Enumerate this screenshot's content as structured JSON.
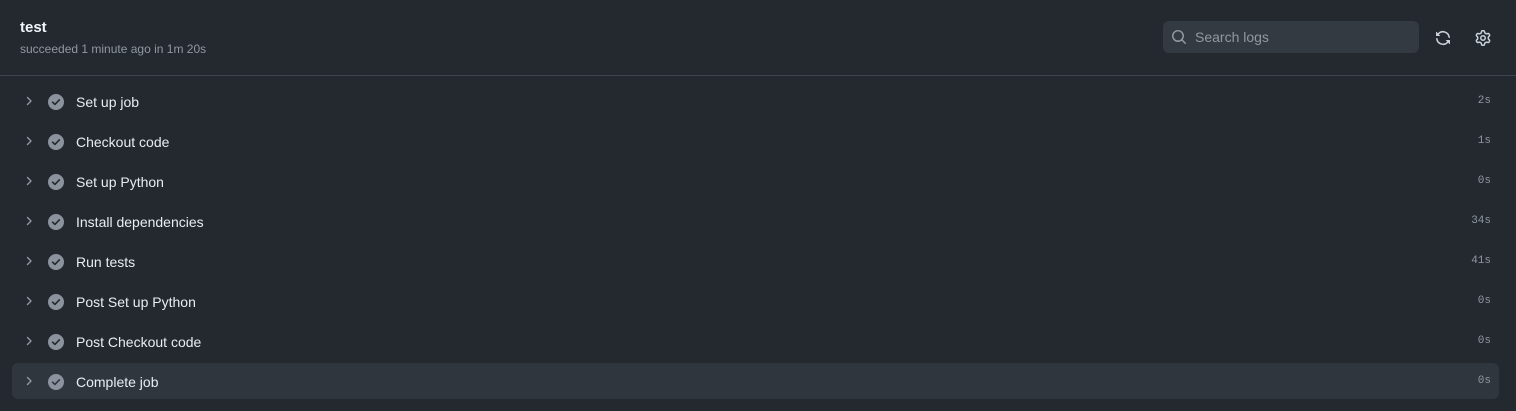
{
  "job": {
    "title": "test",
    "subtitle": "succeeded 1 minute ago in 1m 20s"
  },
  "search": {
    "placeholder": "Search logs",
    "value": ""
  },
  "toolbar": {
    "refresh_icon": "sync-icon",
    "settings_icon": "gear-icon"
  },
  "steps": [
    {
      "name": "Set up job",
      "duration": "2s",
      "status": "success"
    },
    {
      "name": "Checkout code",
      "duration": "1s",
      "status": "success"
    },
    {
      "name": "Set up Python",
      "duration": "0s",
      "status": "success"
    },
    {
      "name": "Install dependencies",
      "duration": "34s",
      "status": "success"
    },
    {
      "name": "Run tests",
      "duration": "41s",
      "status": "success"
    },
    {
      "name": "Post Set up Python",
      "duration": "0s",
      "status": "success"
    },
    {
      "name": "Post Checkout code",
      "duration": "0s",
      "status": "success"
    },
    {
      "name": "Complete job",
      "duration": "0s",
      "status": "success"
    }
  ],
  "colors": {
    "background": "#24292f",
    "hover_row": "#30363d",
    "success_check": "#8b949e",
    "muted_text": "#9198a1"
  }
}
